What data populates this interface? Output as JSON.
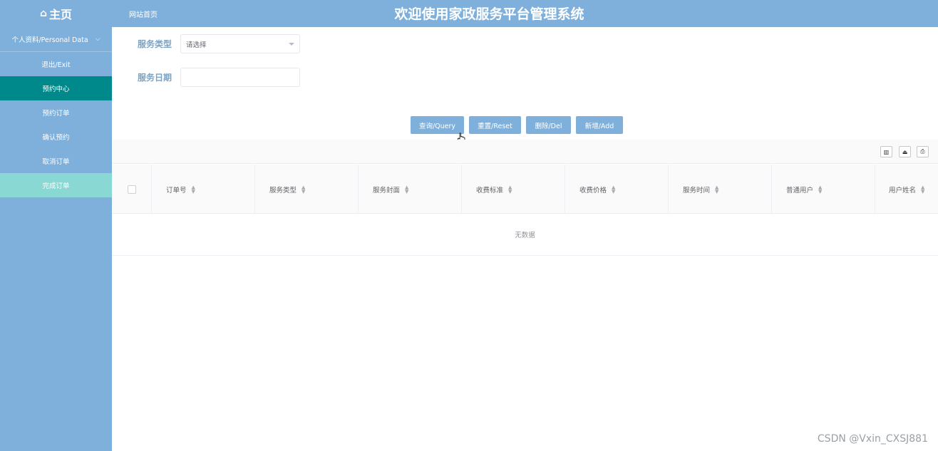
{
  "header": {
    "home_label": "主页",
    "home_icon": "home-icon",
    "site_link": "网站首页",
    "title": "欢迎使用家政服务平台管理系统"
  },
  "sidebar": {
    "group_label": "个人资料/Personal Data",
    "items": [
      {
        "label": "退出/Exit"
      },
      {
        "label": "预约中心"
      },
      {
        "label": "预约订单"
      },
      {
        "label": "确认预约"
      },
      {
        "label": "取消订单"
      },
      {
        "label": "完成订单"
      }
    ]
  },
  "form": {
    "service_type_label": "服务类型",
    "service_type_placeholder": "请选择",
    "service_date_label": "服务日期",
    "service_date_value": ""
  },
  "buttons": {
    "query": "查询/Query",
    "reset": "重置/Reset",
    "delete": "删除/Del",
    "add": "新增/Add"
  },
  "table": {
    "columns": [
      "订单号",
      "服务类型",
      "服务封面",
      "收费标准",
      "收费价格",
      "服务时间",
      "普通用户",
      "用户姓名"
    ],
    "empty_text": "无数据"
  },
  "watermark": "CSDN @Vxin_CXSJ881",
  "colors": {
    "header_bg": "#7fb0dc",
    "active_item": "#00898b",
    "highlight_item": "#8ad8d3",
    "button": "#7fb0dc"
  }
}
